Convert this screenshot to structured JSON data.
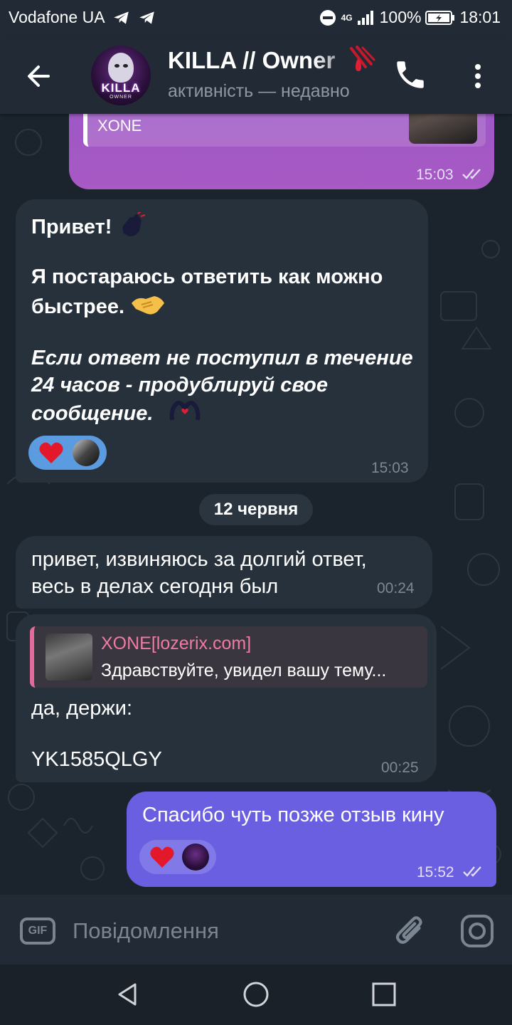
{
  "status_bar": {
    "carrier": "Vodafone UA",
    "network": "4G",
    "battery": "100%",
    "time": "18:01",
    "icons": [
      "telegram-icon",
      "telegram-icon",
      "dnd-icon",
      "signal-icon",
      "battery-charging-icon"
    ]
  },
  "header": {
    "title": "KILLA // Owner",
    "status": "активність — недавно",
    "avatar_text": "KILLA",
    "avatar_subtext": "OWNER",
    "icons": [
      "back-arrow-icon",
      "phone-icon",
      "more-vertical-icon",
      "blood-drop-icon"
    ]
  },
  "messages": {
    "top_partial": {
      "reply_name_partial": "XONE",
      "time": "15:03",
      "status": "read"
    },
    "greeting": {
      "line1": "Привет!",
      "line2": "Я постараюсь ответить как можно",
      "line3": "быстрее.",
      "italic_line1": "Если ответ не поступил в течение",
      "italic_line2": "24 часов - продублируй свое",
      "italic_line3": "сообщение.",
      "time": "15:03",
      "reaction": "heart"
    },
    "date_separator": "12 червня",
    "reply1": {
      "line1": "привет, извиняюсь за долгий ответ,",
      "line2": "весь в делах сегодня был",
      "time": "00:24"
    },
    "reply2": {
      "quote_name": "XONE[lozerix.com]",
      "quote_text": "Здравствуйте, увидел вашу тему...",
      "line1": "да, держи:",
      "line2": "YK1585QLGY",
      "time": "00:25"
    },
    "outgoing": {
      "text": "Спасибо чуть позже отзыв кину",
      "time": "15:52",
      "status": "read",
      "reaction": "heart"
    }
  },
  "input_bar": {
    "gif_label": "GIF",
    "placeholder": "Повідомлення",
    "icons": [
      "gif-icon",
      "paperclip-icon",
      "camera-icon"
    ]
  },
  "nav_bar": {
    "icons": [
      "nav-back-icon",
      "nav-home-icon",
      "nav-recents-icon"
    ]
  },
  "colors": {
    "background": "#1b232c",
    "header": "#222b35",
    "incoming_bubble": "#27313c",
    "outgoing_bubble_purple": "#a859c3",
    "outgoing_bubble_blue": "#6a5fe0",
    "reply_accent": "#e36a9c"
  }
}
